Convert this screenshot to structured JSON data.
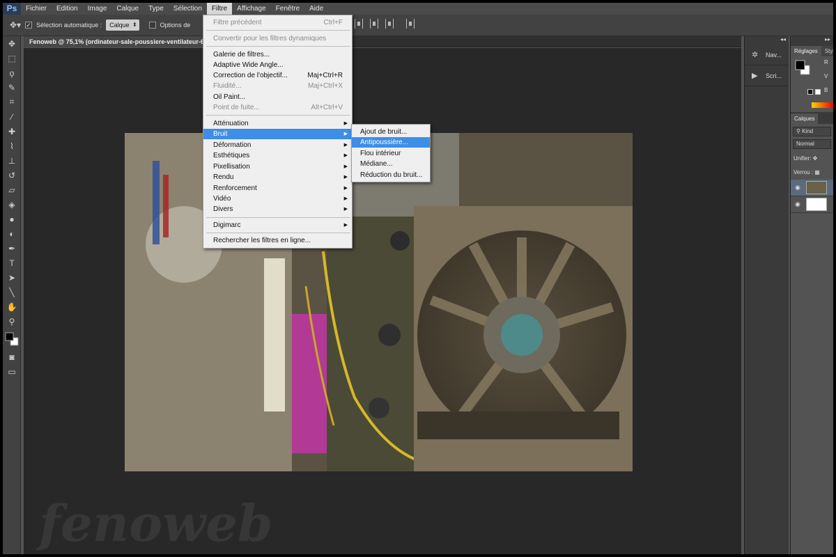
{
  "app": {
    "logo": "Ps"
  },
  "menubar": {
    "items": [
      "Fichier",
      "Edition",
      "Image",
      "Calque",
      "Type",
      "Sélection",
      "Filtre",
      "Affichage",
      "Fenêtre",
      "Aide"
    ]
  },
  "options_bar": {
    "auto_select_label": "Sélection automatique :",
    "auto_select_value": "Calque",
    "transform_label": "Options de"
  },
  "document": {
    "tab_title": "Fenoweb @ 75,1% (ordinateur-sale-poussiere-ventilateur-6..."
  },
  "filter_menu": {
    "items": [
      {
        "label": "Filtre précédent",
        "shortcut": "Ctrl+F",
        "disabled": true
      },
      {
        "label": "Convertir pour les filtres dynamiques",
        "disabled": true
      },
      {
        "label": "Galerie de filtres..."
      },
      {
        "label": "Adaptive Wide Angle..."
      },
      {
        "label": "Correction de l'objectif...",
        "shortcut": "Maj+Ctrl+R"
      },
      {
        "label": "Fluidité...",
        "shortcut": "Maj+Ctrl+X",
        "disabled": true
      },
      {
        "label": "Oil Paint..."
      },
      {
        "label": "Point de fuite...",
        "shortcut": "Alt+Ctrl+V",
        "disabled": true
      },
      {
        "label": "Atténuation",
        "submenu": true
      },
      {
        "label": "Bruit",
        "submenu": true,
        "highlighted": true
      },
      {
        "label": "Déformation",
        "submenu": true
      },
      {
        "label": "Esthétiques",
        "submenu": true
      },
      {
        "label": "Pixellisation",
        "submenu": true
      },
      {
        "label": "Rendu",
        "submenu": true
      },
      {
        "label": "Renforcement",
        "submenu": true
      },
      {
        "label": "Vidéo",
        "submenu": true
      },
      {
        "label": "Divers",
        "submenu": true
      },
      {
        "label": "Digimarc",
        "submenu": true
      },
      {
        "label": "Rechercher les filtres en ligne..."
      }
    ]
  },
  "noise_submenu": {
    "items": [
      {
        "label": "Ajout de bruit..."
      },
      {
        "label": "Antipoussière...",
        "highlighted": true
      },
      {
        "label": "Flou intérieur"
      },
      {
        "label": "Médiane..."
      },
      {
        "label": "Réduction du bruit..."
      }
    ]
  },
  "side_dock": {
    "items": [
      {
        "label": "Nav...",
        "icon": "navigator-icon"
      },
      {
        "label": "Scri...",
        "icon": "play-icon"
      }
    ]
  },
  "panels": {
    "color_tabs": [
      "Réglages",
      "Styles"
    ],
    "channels": [
      "R",
      "V",
      "B"
    ],
    "layers_tab": "Calques",
    "kind_label": "Kind",
    "blend_mode": "Normal",
    "unify_label": "Unifier:",
    "lock_label": "Verrou :"
  },
  "watermark": "fenoweb",
  "colors": {
    "accent": "#3d8ee6",
    "canvas_bg": "#282828",
    "ui_bg": "#535353"
  }
}
